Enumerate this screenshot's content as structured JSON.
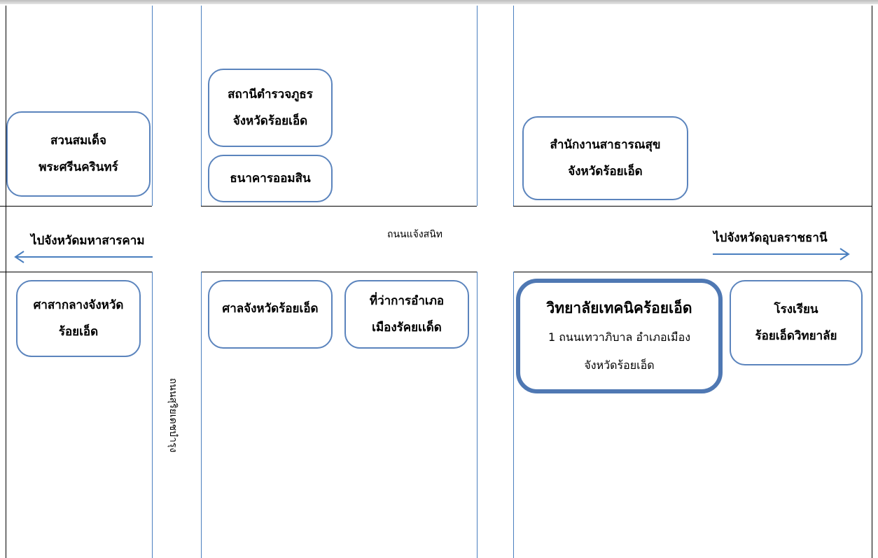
{
  "map": {
    "roads": {
      "main_road": "ถนนแจ้งสนิท",
      "side_road": "ถนนสุริยเดชบำรุง"
    },
    "directions": {
      "west": "ไปจังหวัดมหาสารคาม",
      "east": "ไปจังหวัดอุบลราชธานี"
    },
    "places": {
      "park": [
        "สวนสมเด็จ",
        "พระศรีนครินทร์"
      ],
      "police": [
        "สถานีตำรวจภูธร",
        "จังหวัดร้อยเอ็ด"
      ],
      "bank": [
        "ธนาคารออมสิน"
      ],
      "health_office": [
        "สำนักงานสาธารณสุข",
        "จังหวัดร้อยเอ็ด"
      ],
      "provincial_hall": [
        "ศาสากลางจังหวัด",
        "ร้อยเอ็ด"
      ],
      "court": [
        "ศาลจังหวัดร้อยเอ็ด"
      ],
      "district_office": [
        "ที่ว่าการอำเภอ",
        "เมืองรัคยเเด็ด"
      ],
      "school": [
        "โรงเรียน",
        "ร้อยเอ็ดวิทยาลัย"
      ]
    },
    "college": {
      "name": "วิทยาลัยเทคนิคร้อยเอ็ด",
      "address_line1": "1 ถนนเทวาภิบาล อำเภอเมือง",
      "address_line2": "จังหวัดร้อยเอ็ด"
    },
    "colors": {
      "box_border": "#5b84bd",
      "road_line": "#4a7fbf",
      "arrow": "#4a7fbf"
    }
  }
}
